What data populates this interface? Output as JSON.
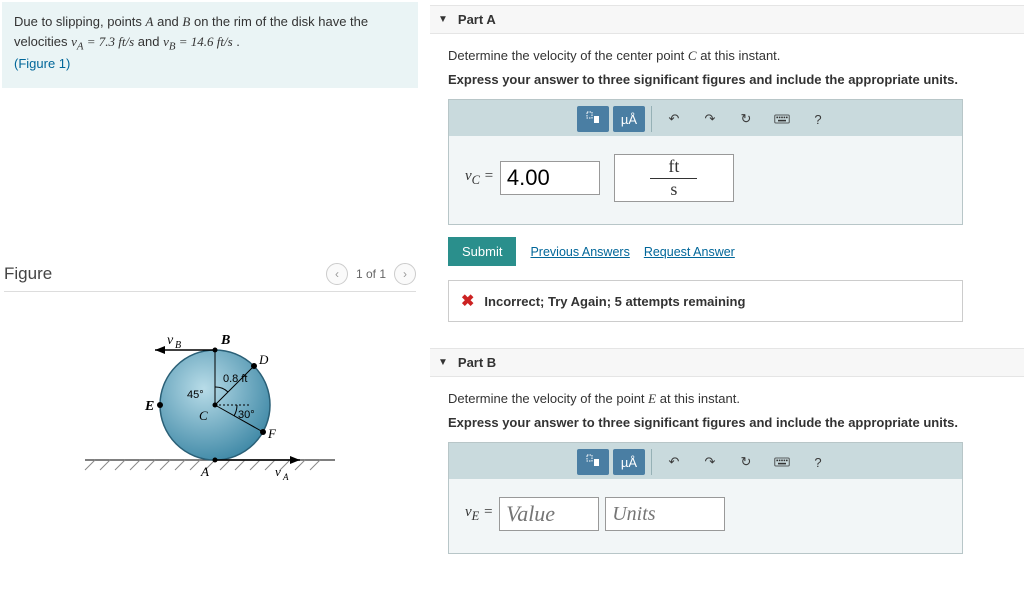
{
  "problem": {
    "text_prefix": "Due to slipping, points ",
    "A": "A",
    "and": " and ",
    "B": "B",
    "text_mid": " on the rim of the disk have the velocities ",
    "va_expr": "v_A = 7.3 ft/s",
    "and2": " and ",
    "vb_expr": "v_B = 14.6 ft/s",
    "period": " .",
    "figure_link": "(Figure 1)"
  },
  "figure": {
    "title": "Figure",
    "pager_label": "1 of 1",
    "labels": {
      "vB": "v_B",
      "B": "B",
      "D": "D",
      "radius": "0.8 ft",
      "ang45": "45°",
      "ang30": "30°",
      "E": "E",
      "C": "C",
      "A": "A",
      "F": "F",
      "vA": "v_A"
    }
  },
  "partA": {
    "header": "Part A",
    "question": "Determine the velocity of the center point C at this instant.",
    "instruction": "Express your answer to three significant figures and include the appropriate units.",
    "var_label": "v_C =",
    "value": "4.00",
    "unit_top": "ft",
    "unit_bot": "s",
    "submit": "Submit",
    "prev_answers": "Previous Answers",
    "request_answer": "Request Answer",
    "feedback": "Incorrect; Try Again; 5 attempts remaining",
    "toolbar": {
      "templates": "⬚",
      "ua": "µÅ",
      "undo": "↶",
      "redo": "↷",
      "reset": "↻",
      "keyboard": "⌨",
      "help": "?"
    }
  },
  "partB": {
    "header": "Part B",
    "question": "Determine the velocity of the point E at this instant.",
    "instruction": "Express your answer to three significant figures and include the appropriate units.",
    "var_label": "v_E =",
    "value_placeholder": "Value",
    "unit_placeholder": "Units",
    "toolbar": {
      "templates": "⬚",
      "ua": "µÅ",
      "undo": "↶",
      "redo": "↷",
      "reset": "↻",
      "keyboard": "⌨",
      "help": "?"
    }
  }
}
